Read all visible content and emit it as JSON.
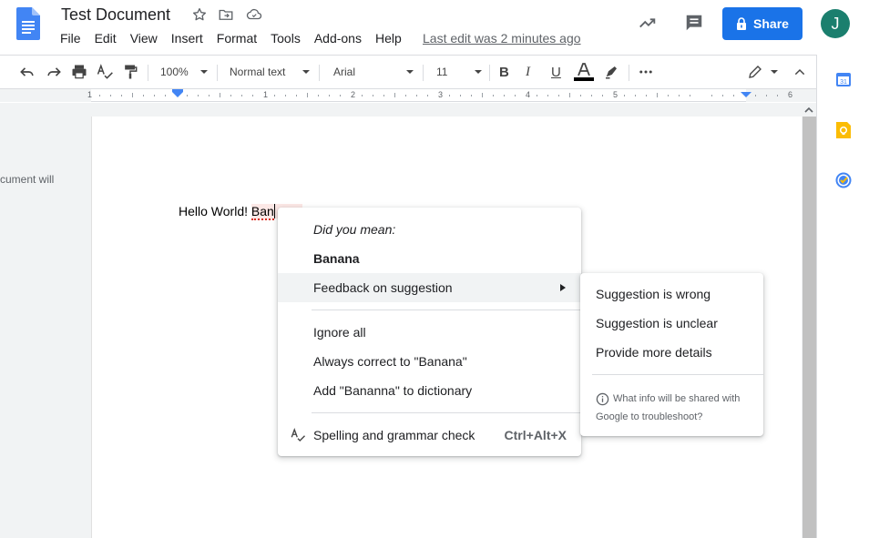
{
  "header": {
    "title": "Test Document",
    "menus": [
      "File",
      "Edit",
      "View",
      "Insert",
      "Format",
      "Tools",
      "Add-ons",
      "Help"
    ],
    "last_edit": "Last edit was 2 minutes ago",
    "share_label": "Share",
    "avatar_initial": "J"
  },
  "toolbar": {
    "zoom": "100%",
    "style": "Normal text",
    "font": "Arial",
    "size": "11"
  },
  "ruler": {
    "labels": [
      "1",
      "1",
      "2",
      "3",
      "4",
      "5",
      "6"
    ]
  },
  "document": {
    "outline_hint": "cument will",
    "text_prefix": "Hello World! ",
    "misspelled_word": "Ban"
  },
  "context_menu": {
    "did_you_mean": "Did you mean:",
    "suggestion": "Banana",
    "feedback": "Feedback on suggestion",
    "ignore_all": "Ignore all",
    "always_correct": "Always correct to \"Banana\"",
    "add_dictionary": "Add \"Bananna\" to dictionary",
    "spelling_check": "Spelling and grammar check",
    "spelling_shortcut": "Ctrl+Alt+X"
  },
  "submenu": {
    "wrong": "Suggestion is wrong",
    "unclear": "Suggestion is unclear",
    "more_details": "Provide more details",
    "info_line1": "What info will be shared with",
    "info_line2": "Google to troubleshoot?"
  },
  "colors": {
    "share_blue": "#1a73e8",
    "avatar_green": "#1b7f6e",
    "docs_blue": "#4285f4",
    "misspell_red": "#d93025"
  }
}
